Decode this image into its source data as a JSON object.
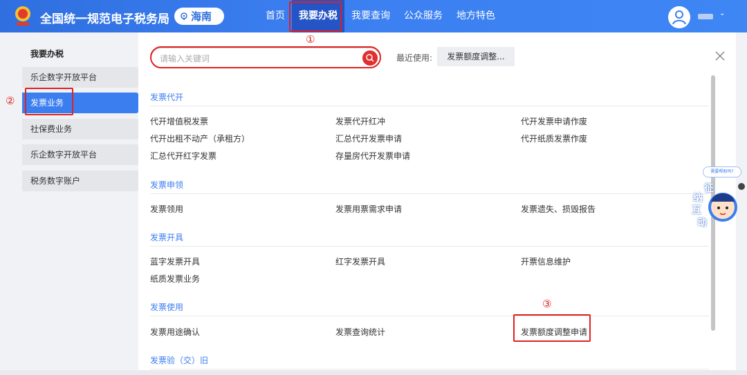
{
  "header": {
    "brand": "全国统一规范电子税务局",
    "region": "海南",
    "nav": [
      "首页",
      "我要办税",
      "我要查询",
      "公众服务",
      "地方特色"
    ],
    "active_nav": "我要办税"
  },
  "sidebar": {
    "title": "我要办税",
    "items": [
      "乐企数字开放平台",
      "发票业务",
      "社保费业务",
      "乐企数字开放平台",
      "税务数字账户"
    ],
    "active_item": "发票业务"
  },
  "search": {
    "placeholder": "请输入关键词",
    "recent_label": "最近使用:",
    "recent_item": "发票额度调整..."
  },
  "sections": [
    {
      "title": "发票代开",
      "links": [
        "代开增值税发票",
        "发票代开红冲",
        "代开发票申请作废",
        "代开出租不动产（承租方）",
        "汇总代开发票申请",
        "代开纸质发票作废",
        "汇总代开红字发票",
        "存量房代开发票申请"
      ]
    },
    {
      "title": "发票申领",
      "links": [
        "发票领用",
        "发票用票需求申请",
        "发票遗失、损毁报告"
      ]
    },
    {
      "title": "发票开具",
      "links": [
        "蓝字发票开具",
        "红字发票开具",
        "开票信息维护",
        "纸质发票业务"
      ]
    },
    {
      "title": "发票使用",
      "links": [
        "发票用途确认",
        "发票查询统计",
        "发票额度调整申请"
      ]
    },
    {
      "title": "发票验（交）旧",
      "links": []
    }
  ],
  "annotations": {
    "step1": "①",
    "step2": "②",
    "step3": "③",
    "color": "#e02020"
  },
  "helper": {
    "bubble": "需要帮助吗?",
    "chars": [
      "征",
      "纳",
      "互",
      "动"
    ]
  },
  "colors": {
    "header_blue": "#3b7ef0",
    "active_nav": "#2554c7",
    "accent_red": "#e03030",
    "section_blue": "#3b7ef0"
  }
}
